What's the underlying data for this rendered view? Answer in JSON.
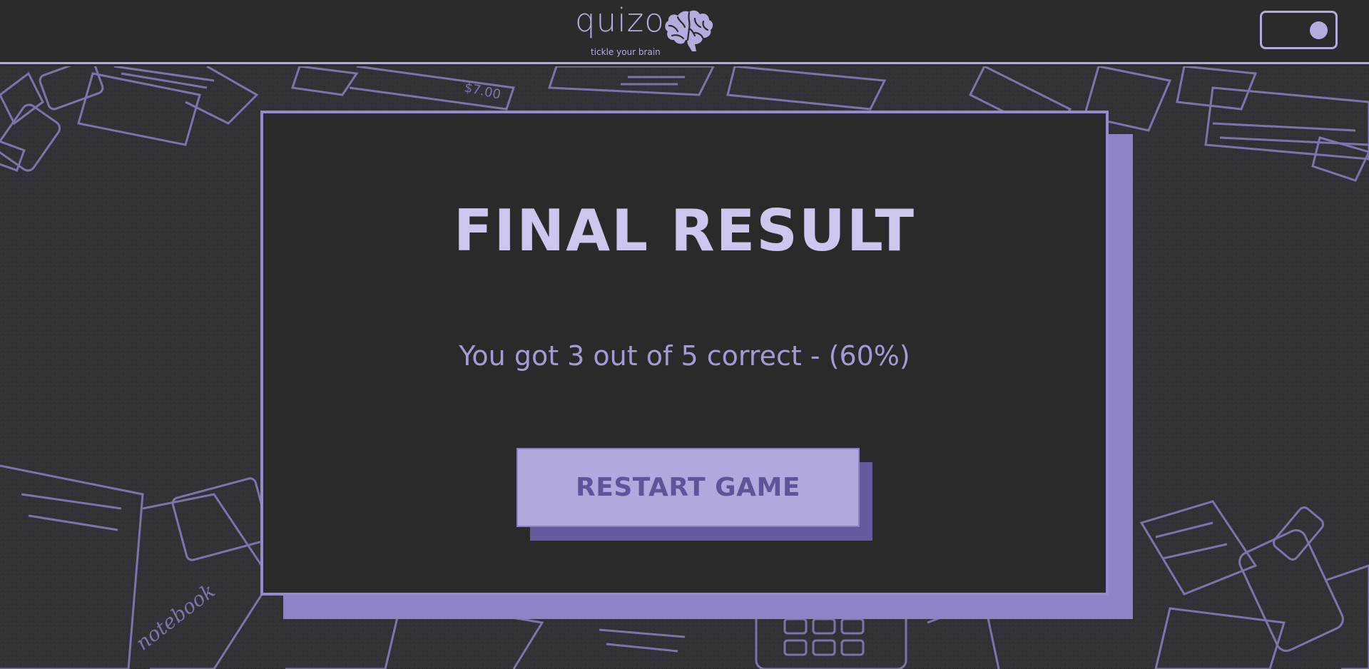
{
  "header": {
    "logo_text": "quizo",
    "tagline": "tickle your brain",
    "logo_icon": "brain-icon",
    "theme_toggle_icon": "toggle-switch-icon",
    "accent_color": "#b4acdf"
  },
  "result": {
    "title": "FINAL RESULT",
    "score_text": "You got 3 out of 5 correct - (60%)",
    "restart_label": "RESTART GAME"
  },
  "background": {
    "illustration": "desk-items-pattern",
    "price_tag_text": "$7.00",
    "notebook_text": "notebook"
  },
  "colors": {
    "page_bg": "#2b2b2b",
    "card_bg": "#2a2a2a",
    "card_border": "#948bcd",
    "card_shadow": "#8d84c5",
    "button_bg": "#b1a9de",
    "button_text": "#5f5499",
    "button_shadow": "#655a9e"
  }
}
